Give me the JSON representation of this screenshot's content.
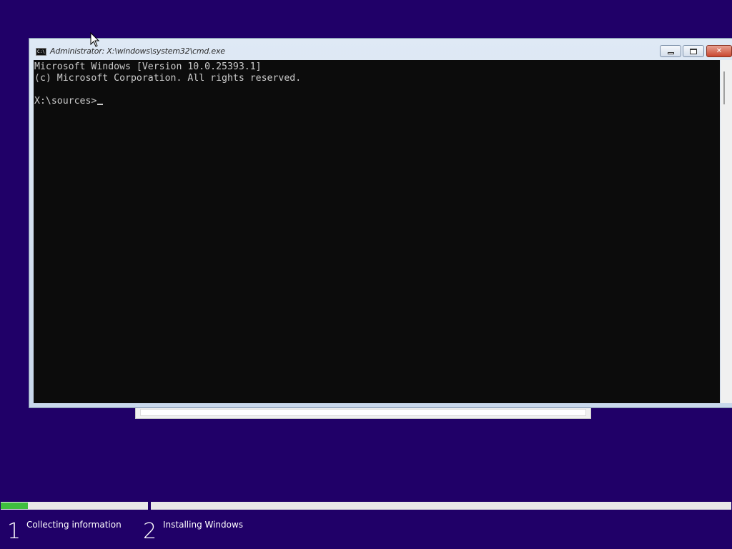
{
  "cmd_window": {
    "title": "Administrator: X:\\windows\\system32\\cmd.exe",
    "icon_label": "C:\\",
    "buttons": {
      "minimize": "minimize-icon",
      "maximize": "restore-icon",
      "close": "✕"
    },
    "console_lines": [
      "Microsoft Windows [Version 10.0.25393.1]",
      "(c) Microsoft Corporation. All rights reserved.",
      "",
      "X:\\sources>"
    ]
  },
  "setup_progress": {
    "progress_fraction": 0.185,
    "steps": [
      {
        "number": "1",
        "label": "Collecting information"
      },
      {
        "number": "2",
        "label": "Installing Windows"
      }
    ]
  },
  "colors": {
    "background": "#200068",
    "console_bg": "#0c0c0c",
    "console_text": "#cccccc",
    "progress_fill": "#3fbe3f"
  }
}
